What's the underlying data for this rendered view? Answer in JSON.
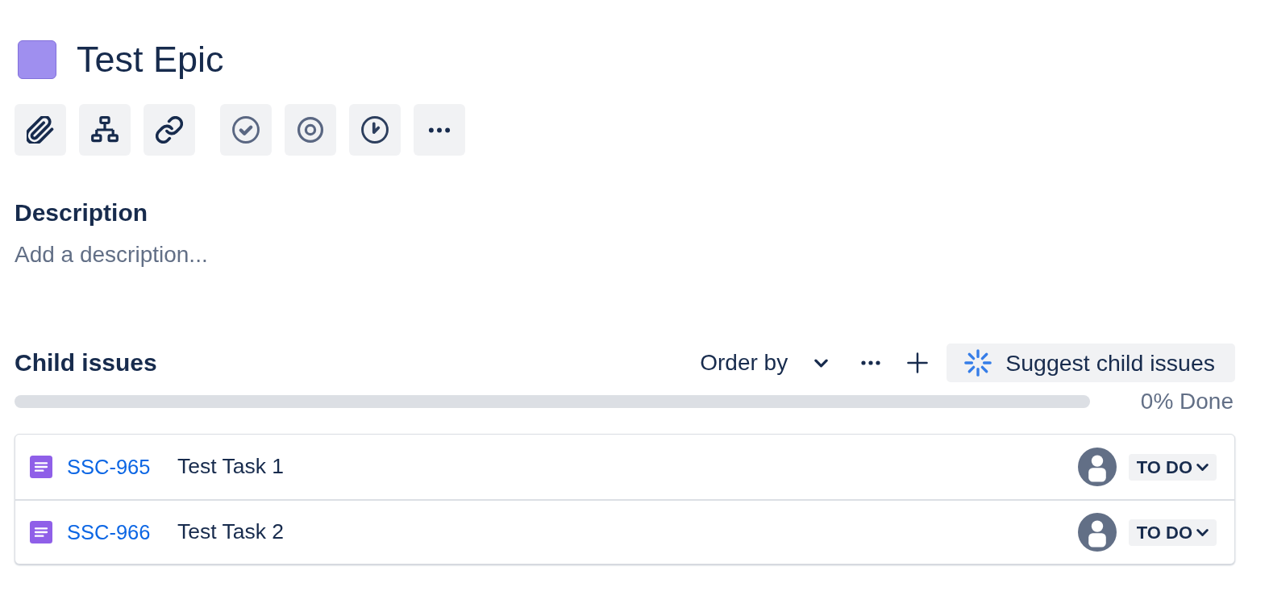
{
  "epic": {
    "title": "Test Epic"
  },
  "description": {
    "heading": "Description",
    "placeholder": "Add a description..."
  },
  "child_issues": {
    "heading": "Child issues",
    "order_by": "Order by",
    "suggest_button": "Suggest child issues",
    "progress": {
      "level": 0,
      "reading": "0% Done"
    },
    "rows": [
      {
        "key": "SSC-965",
        "summary": "Test Task 1",
        "status": "TO DO"
      },
      {
        "key": "SSC-966",
        "summary": "Test Task 2",
        "status": "TO DO"
      }
    ]
  }
}
